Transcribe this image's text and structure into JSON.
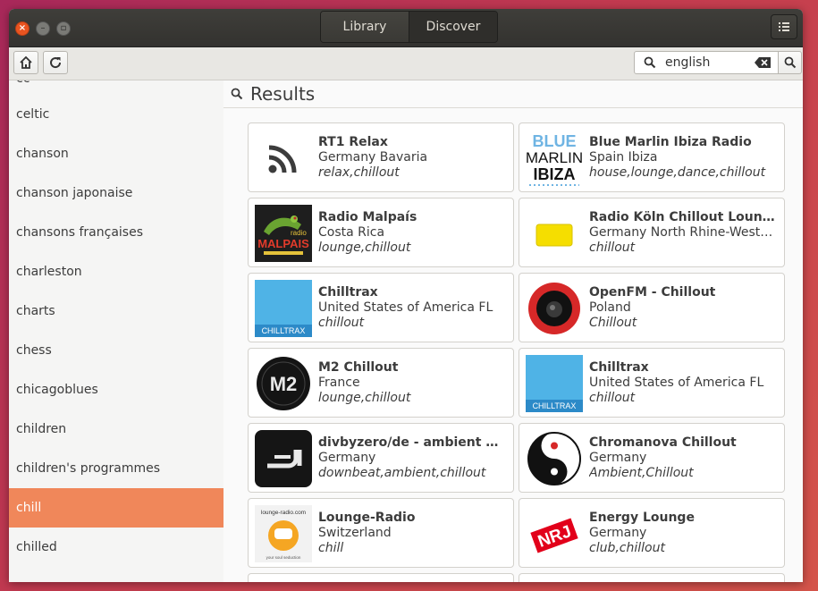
{
  "window": {
    "tabs": [
      {
        "label": "Library",
        "active": false
      },
      {
        "label": "Discover",
        "active": true
      }
    ]
  },
  "toolbar": {
    "search_value": "english",
    "icons": [
      "home-icon",
      "refresh-icon",
      "search-icon",
      "clear-icon",
      "menu-icon"
    ]
  },
  "sidebar": {
    "partial_top": "cc",
    "items": [
      {
        "label": "celtic"
      },
      {
        "label": "chanson"
      },
      {
        "label": "chanson japonaise"
      },
      {
        "label": "chansons françaises"
      },
      {
        "label": "charleston"
      },
      {
        "label": "charts"
      },
      {
        "label": "chess"
      },
      {
        "label": "chicagoblues"
      },
      {
        "label": "children"
      },
      {
        "label": "children's programmes"
      },
      {
        "label": "chill",
        "selected": true
      },
      {
        "label": "chilled"
      }
    ]
  },
  "results": {
    "title": "Results",
    "stations": [
      {
        "name": "RT1 Relax",
        "location": "Germany Bavaria",
        "tags": "relax,chillout",
        "logo": "rss-icon"
      },
      {
        "name": "Blue Marlin Ibiza Radio",
        "location": "Spain Ibiza",
        "tags": "house,lounge,dance,chillout",
        "logo": "blue-marlin-logo",
        "logo_text": [
          "BLUE",
          "MARLIN",
          "IBIZA"
        ]
      },
      {
        "name": "Radio Malpaís",
        "location": "Costa Rica",
        "tags": "lounge,chillout",
        "logo": "malpais-logo",
        "logo_text": [
          "radio",
          "MALPAIS"
        ]
      },
      {
        "name": "Radio Köln Chillout Lounge",
        "location": "Germany North Rhine-Westphalia",
        "tags": "chillout",
        "logo": "yellow-box-logo"
      },
      {
        "name": "Chilltrax",
        "location": "United States of America FL",
        "tags": "chillout",
        "logo": "chilltrax-logo",
        "logo_text": [
          "CHILLTRAX"
        ]
      },
      {
        "name": "OpenFM - Chillout",
        "location": "Poland",
        "tags": "Chillout",
        "logo": "openfm-logo"
      },
      {
        "name": "M2 Chillout",
        "location": "France",
        "tags": "lounge,chillout",
        "logo": "m2-logo",
        "logo_text": [
          "M2"
        ]
      },
      {
        "name": "Chilltrax",
        "location": "United States of America FL",
        "tags": "chillout",
        "logo": "chilltrax-logo",
        "logo_text": [
          "CHILLTRAX"
        ]
      },
      {
        "name": "divbyzero/de - ambient & chillout",
        "location": "Germany",
        "tags": "downbeat,ambient,chillout",
        "logo": "divbyzero-logo"
      },
      {
        "name": "Chromanova Chillout",
        "location": "Germany",
        "tags": "Ambient,Chillout",
        "logo": "yin-yang-logo"
      },
      {
        "name": "Lounge-Radio",
        "location": "Switzerland",
        "tags": "chill",
        "logo": "lounge-radio-logo",
        "logo_text": [
          "lounge-radio.com",
          "your soul seduction"
        ]
      },
      {
        "name": "Energy Lounge",
        "location": "Germany",
        "tags": "club,chillout",
        "logo": "nrj-logo",
        "logo_text": [
          "NRJ"
        ]
      }
    ]
  },
  "colors": {
    "selection": "#f0875a",
    "titlebar": "#3a3935",
    "chilltrax": "#4fb3e6",
    "blue_marlin": "#6fb4e3",
    "openfm_red": "#d62828",
    "radio_koeln_yellow": "#f5de00"
  }
}
